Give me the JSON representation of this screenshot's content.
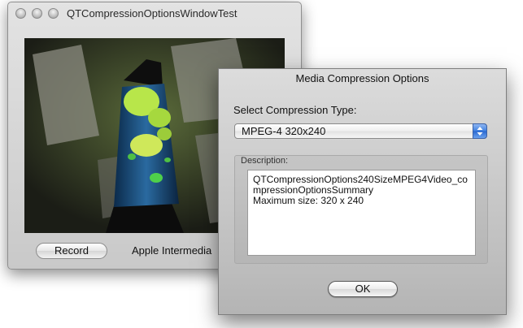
{
  "main_window": {
    "title": "QTCompressionOptionsWindowTest",
    "record_label": "Record",
    "codec_label": "Apple Intermedia"
  },
  "sheet": {
    "title": "Media Compression Options",
    "select_label": "Select Compression Type:",
    "selected_type": "MPEG-4 320x240",
    "description_label": "Description:",
    "description_lines": [
      "QTCompressionOptions240SizeMPEG4Video_co",
      "mpressionOptionsSummary",
      "Maximum size: 320 x 240"
    ],
    "ok_label": "OK"
  },
  "icons": {
    "window_buttons": [
      "close-icon",
      "minimize-icon",
      "zoom-icon"
    ],
    "popup": "up-down-arrows-icon"
  },
  "colors": {
    "popup_accent": "#3d7fe0",
    "video_glow": "#b8e64a"
  }
}
